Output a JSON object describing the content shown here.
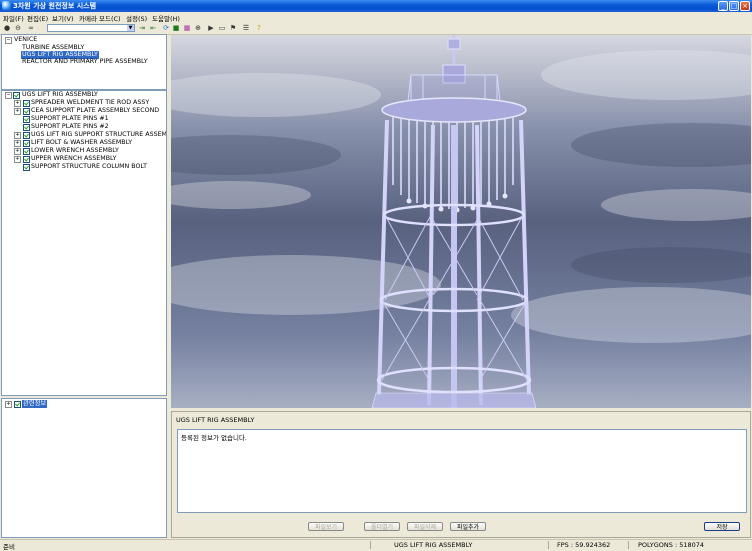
{
  "window": {
    "title": "3차원 가상 원전정보 시스템"
  },
  "menu": [
    {
      "label": "파일(F)"
    },
    {
      "label": "편집(E)"
    },
    {
      "label": "보기(V)"
    },
    {
      "label": "카메라 모드(C)"
    },
    {
      "label": "설정(S)"
    },
    {
      "label": "도움말(H)"
    }
  ],
  "toolbar": {
    "combo_value": ""
  },
  "project_tree": {
    "root": "VENICE",
    "items": [
      {
        "label": "TURBINE ASSEMBLY",
        "selected": false
      },
      {
        "label": "UGS LIFT RIG ASSEMBLY",
        "selected": true
      },
      {
        "label": "REACTOR AND PRIMARY PIPE ASSEMBLY",
        "selected": false
      }
    ]
  },
  "assembly_tree": {
    "root": "UGS LIFT RIG ASSEMBLY",
    "items": [
      {
        "label": "SPREADER WELDMENT TIE ROD ASSY",
        "expandable": true
      },
      {
        "label": "CEA SUPPORT PLATE ASSEMBLY SECOND",
        "expandable": true
      },
      {
        "label": "SUPPORT PLATE PINS #1",
        "expandable": false
      },
      {
        "label": "SUPPORT PLATE PINS #2",
        "expandable": false
      },
      {
        "label": "UGS LIFT RIG SUPPORT STRUCTURE ASSEMBLY",
        "expandable": true
      },
      {
        "label": "LIFT BOLT & WASHER ASSEMBLY",
        "expandable": true
      },
      {
        "label": "LOWER WRENCH ASSEMBLY",
        "expandable": true
      },
      {
        "label": "UPPER WRENCH ASSEMBLY",
        "expandable": true
      },
      {
        "label": "SUPPORT STRUCTURE COLUMN BOLT",
        "expandable": false
      }
    ]
  },
  "bottom_tree": {
    "label": "관련정보"
  },
  "info_panel": {
    "title": "UGS LIFT RIG ASSEMBLY",
    "text": "등록된 정보가 없습니다.",
    "buttons": [
      {
        "label": "파일보기",
        "enabled": false
      },
      {
        "label": "폴더열기",
        "enabled": false
      },
      {
        "label": "파일삭제",
        "enabled": false
      },
      {
        "label": "파일추가",
        "enabled": true
      }
    ],
    "save_label": "저장"
  },
  "status": {
    "ready": "준비",
    "assembly": "UGS LIFT RIG ASSEMBLY",
    "fps": "FPS : 59.924362",
    "polygons": "POLYGONS : 518074"
  },
  "colors": {
    "titlebar": "#0a5ad8",
    "selection": "#316ac5",
    "model": "#b8b8ec"
  }
}
